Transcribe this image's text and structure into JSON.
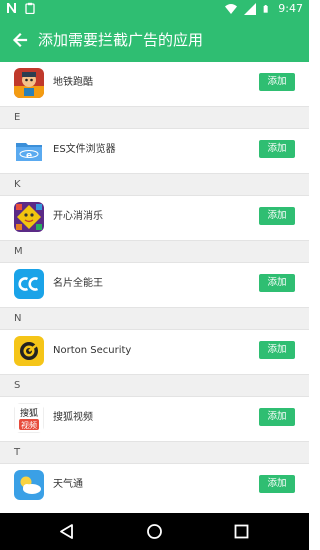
{
  "status_bar": {
    "time": "9:47",
    "icons": [
      "notification-n-icon",
      "clipboard-icon",
      "wifi-icon",
      "cellular-signal-icon",
      "battery-icon"
    ]
  },
  "app_bar": {
    "title": "添加需要拦截广告的应用",
    "back_icon": "arrow-left-icon"
  },
  "rows": [
    {
      "type": "app",
      "name": "地铁跑酷",
      "button": "添加",
      "icon": "subway-surfers-icon"
    },
    {
      "type": "section",
      "letter": "E"
    },
    {
      "type": "app",
      "name": "ES文件浏览器",
      "button": "添加",
      "icon": "es-file-explorer-icon"
    },
    {
      "type": "section",
      "letter": "K"
    },
    {
      "type": "app",
      "name": "开心消消乐",
      "button": "添加",
      "icon": "happy-elimination-icon"
    },
    {
      "type": "section",
      "letter": "M"
    },
    {
      "type": "app",
      "name": "名片全能王",
      "button": "添加",
      "icon": "camcard-icon"
    },
    {
      "type": "section",
      "letter": "N"
    },
    {
      "type": "app",
      "name": "Norton Security",
      "button": "添加",
      "icon": "norton-security-icon"
    },
    {
      "type": "section",
      "letter": "S"
    },
    {
      "type": "app",
      "name": "搜狐视频",
      "button": "添加",
      "icon": "sohu-video-icon",
      "icon_text": [
        "搜狐",
        "视频"
      ]
    },
    {
      "type": "section",
      "letter": "T"
    },
    {
      "type": "app",
      "name": "天气通",
      "button": "添加",
      "icon": "weather-app-icon"
    }
  ],
  "nav_bar": {
    "icons": [
      "back-triangle-icon",
      "home-circle-icon",
      "recents-square-icon"
    ]
  },
  "colors": {
    "accent": "#2fbe72",
    "section_bg": "#f0f0f0",
    "nav_bg": "#000000"
  }
}
